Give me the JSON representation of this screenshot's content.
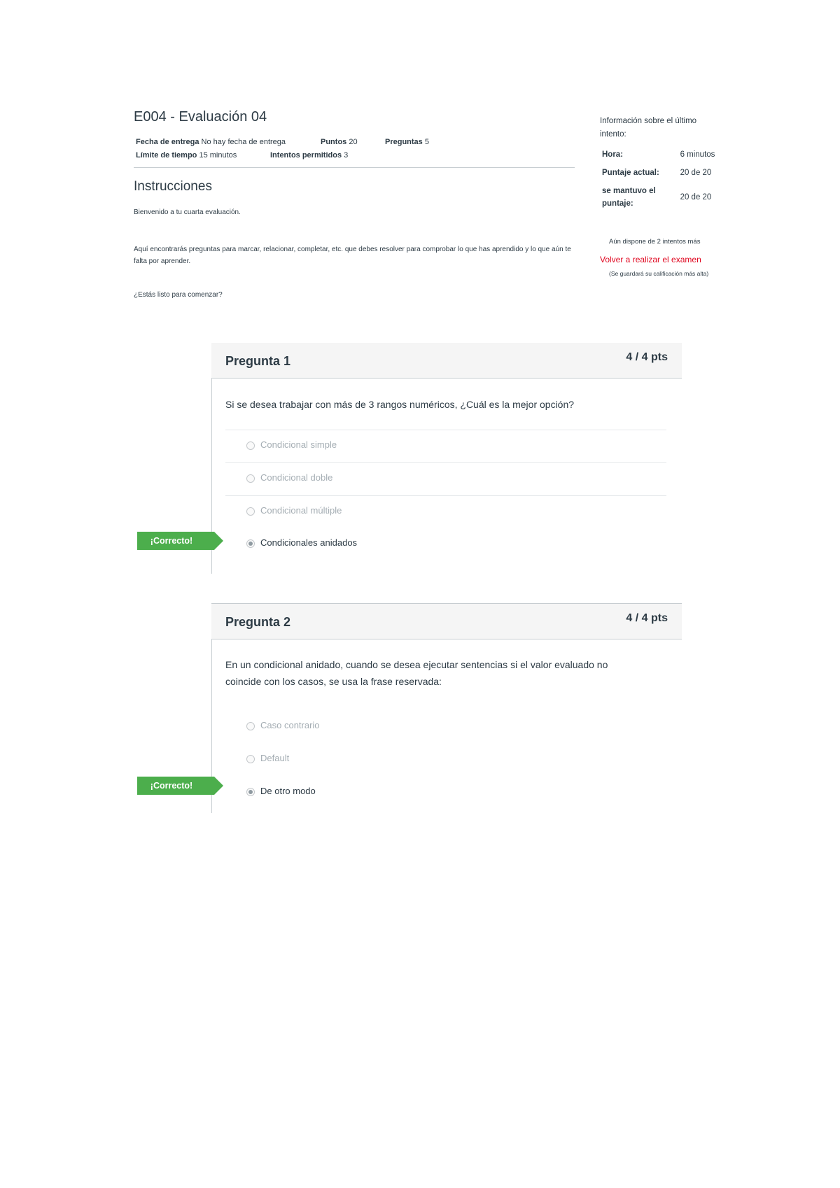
{
  "quiz": {
    "title": "E004 - Evaluación 04",
    "due_label": "Fecha de entrega",
    "due_value": "No hay fecha de entrega",
    "points_label": "Puntos",
    "points_value": "20",
    "questions_label": "Preguntas",
    "questions_value": "5",
    "time_limit_label": "Límite de tiempo",
    "time_limit_value": "15 minutos",
    "attempts_label": "Intentos permitidos",
    "attempts_value": "3"
  },
  "instructions": {
    "heading": "Instrucciones",
    "welcome": "Bienvenido a tu cuarta evaluación.",
    "body": "Aquí encontrarás preguntas para marcar, relacionar, completar, etc. que debes resolver para comprobar lo que has aprendido y lo que aún te falta por aprender.",
    "ready": "¿Estás listo para comenzar?"
  },
  "sidebar": {
    "heading": "Información sobre el último intento:",
    "time_label": "Hora:",
    "time_value": "6 minutos",
    "score_label": "Puntaje actual:",
    "score_value": "20 de 20",
    "kept_label": "se mantuvo el puntaje:",
    "kept_value": "20 de 20",
    "attempts_left": "Aún dispone de 2 intentos más",
    "retake_link": "Volver a realizar el examen",
    "retake_note": "(Se guardará su calificación más alta)"
  },
  "questions": [
    {
      "title": "Pregunta 1",
      "points": "4 / 4 pts",
      "text": "Si se desea trabajar con más de 3 rangos numéricos, ¿Cuál es la mejor opción?",
      "answers": [
        "Condicional simple",
        "Condicional doble",
        "Condicional múltiple",
        "Condicionales anidados"
      ],
      "correct_flag": "¡Correcto!"
    },
    {
      "title": "Pregunta 2",
      "points": "4 / 4 pts",
      "text": "En un condicional anidado, cuando se desea ejecutar sentencias si el valor evaluado no coincide con los casos, se usa la frase reservada:",
      "answers": [
        "Caso contrario",
        "Default",
        "De otro modo"
      ],
      "correct_flag": "¡Correcto!"
    }
  ]
}
